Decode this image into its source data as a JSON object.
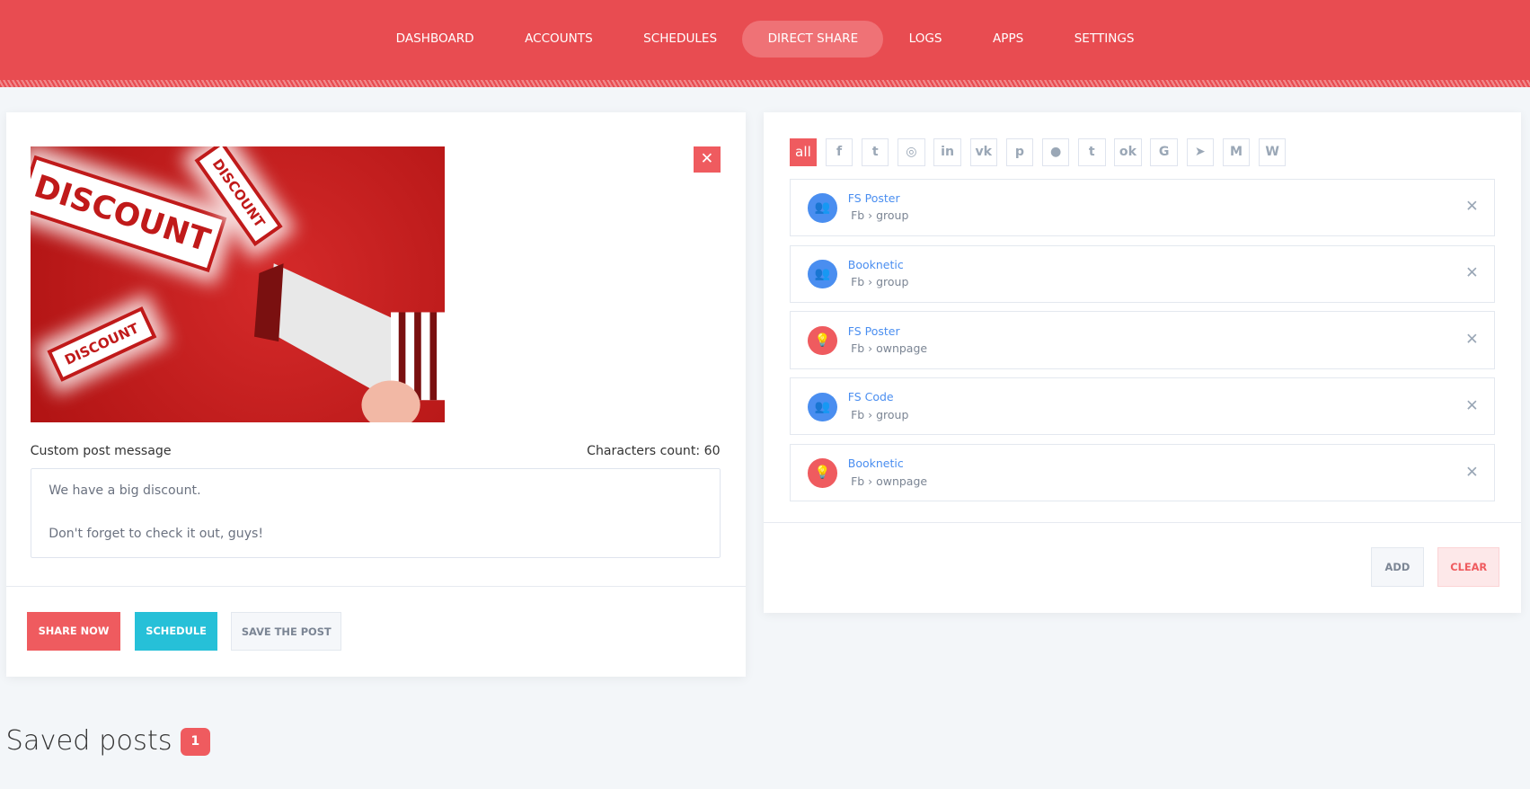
{
  "nav": {
    "items": [
      "DASHBOARD",
      "ACCOUNTS",
      "SCHEDULES",
      "DIRECT SHARE",
      "LOGS",
      "APPS",
      "SETTINGS"
    ],
    "active": "DIRECT SHARE"
  },
  "post": {
    "image_stamps": [
      "DISCOUNT",
      "DISCOUNT",
      "DISCOUNT"
    ],
    "message_label": "Custom post message",
    "char_count": "Characters count: 60",
    "message": "We have a big discount.\n\nDon't forget to check it out, guys!",
    "buttons": {
      "share": "SHARE NOW",
      "schedule": "SCHEDULE",
      "save": "SAVE THE POST"
    },
    "remove_icon": "close-icon"
  },
  "filters": {
    "all": "all",
    "icons": [
      [
        "facebook",
        "f"
      ],
      [
        "twitter",
        "t"
      ],
      [
        "instagram",
        "◎"
      ],
      [
        "linkedin",
        "in"
      ],
      [
        "vk",
        "vk"
      ],
      [
        "pinterest",
        "p"
      ],
      [
        "reddit",
        "r"
      ],
      [
        "tumblr",
        "t"
      ],
      [
        "odnoklassniki",
        "ok"
      ],
      [
        "google",
        "G"
      ],
      [
        "telegram",
        "➤"
      ],
      [
        "medium",
        "M"
      ],
      [
        "wordpress",
        "W"
      ]
    ]
  },
  "accounts": [
    {
      "name": "FS Poster",
      "type": "Fb",
      "sub": "group",
      "icon": "group"
    },
    {
      "name": "Booknetic",
      "type": "Fb",
      "sub": "group",
      "icon": "group"
    },
    {
      "name": "FS Poster",
      "type": "Fb",
      "sub": "ownpage",
      "icon": "page"
    },
    {
      "name": "FS Code",
      "type": "Fb",
      "sub": "group",
      "icon": "group"
    },
    {
      "name": "Booknetic",
      "type": "Fb",
      "sub": "ownpage",
      "icon": "page"
    }
  ],
  "account_actions": {
    "add": "ADD",
    "clear": "CLEAR"
  },
  "saved": {
    "title": "Saved posts",
    "count": "1"
  },
  "colors": {
    "brand": "#e84c51",
    "accent": "#ef5b5f",
    "schedule": "#26c0d8",
    "link": "#4a8ef0"
  }
}
